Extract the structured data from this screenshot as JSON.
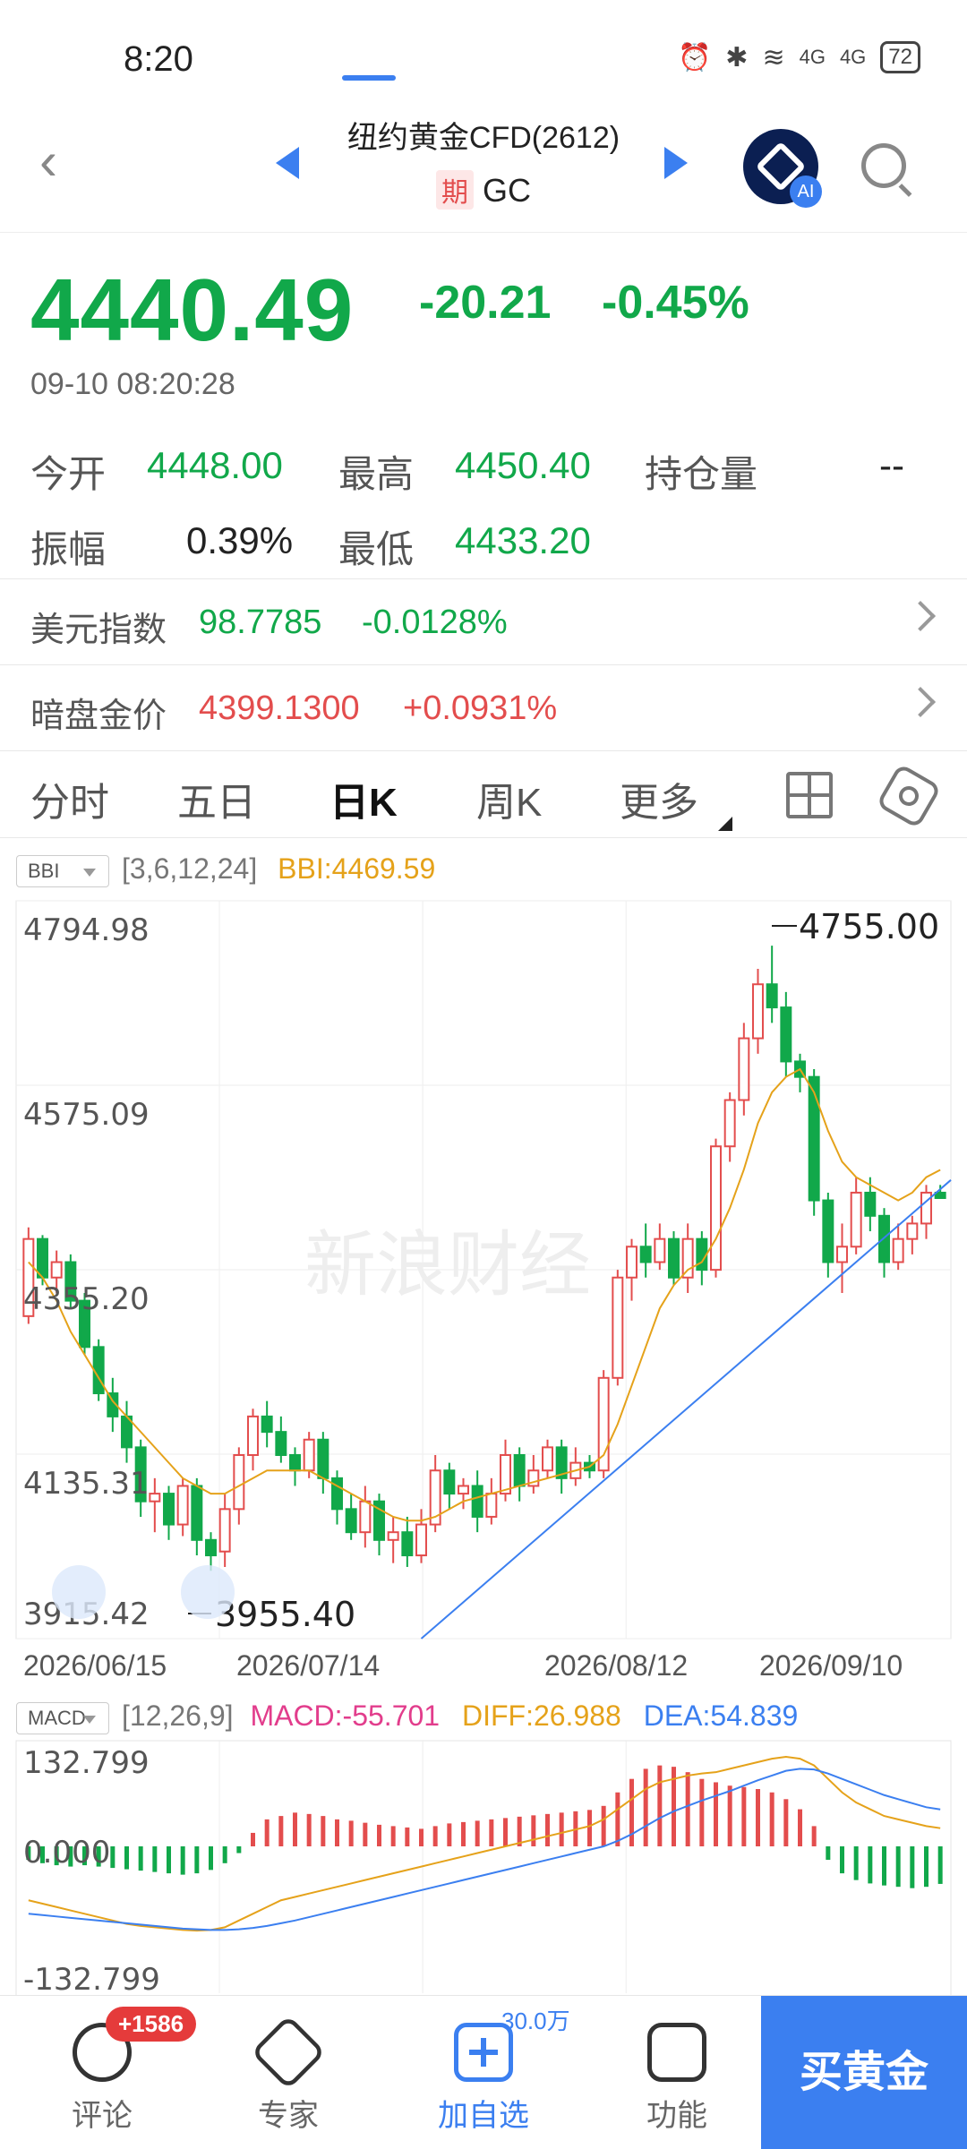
{
  "status_bar": {
    "time": "8:20",
    "battery": "72",
    "signal1": "4G",
    "signal2": "4G"
  },
  "header": {
    "title": "纽约黄金CFD(2612)",
    "subtitle_badge": "期",
    "subtitle": "GC",
    "ai_label": "AI"
  },
  "quote": {
    "price": "4440.49",
    "change": "-20.21",
    "change_pct": "-0.45%",
    "timestamp": "09-10 08:20:28",
    "color_down": "#11a84a",
    "color_up": "#e34d4d"
  },
  "stats": {
    "open_label": "今开",
    "open": "4448.00",
    "high_label": "最高",
    "high": "4450.40",
    "oi_label": "持仓量",
    "oi": "--",
    "amp_label": "振幅",
    "amp": "0.39%",
    "low_label": "最低",
    "low": "4433.20"
  },
  "usd_index": {
    "label": "美元指数",
    "value": "98.7785",
    "change": "-0.0128%"
  },
  "dark_pool": {
    "label": "暗盘金价",
    "value": "4399.1300",
    "change": "+0.0931%"
  },
  "tabs": [
    "分时",
    "五日",
    "日K",
    "周K",
    "更多"
  ],
  "active_tab": "日K",
  "bbi": {
    "select": "BBI",
    "params": "[3,6,12,24]",
    "value": "BBI:4469.59"
  },
  "kline": {
    "y_labels": [
      "4794.98",
      "4575.09",
      "4355.20",
      "4135.31",
      "3915.42"
    ],
    "max_label": "4755.00",
    "min_label": "3955.40",
    "watermark": "新浪财经",
    "dates": [
      "2026/06/15",
      "2026/07/14",
      "2026/08/12",
      "2026/09/10"
    ]
  },
  "macd": {
    "select": "MACD",
    "params": "[12,26,9]",
    "macd": "MACD:-55.701",
    "diff": "DIFF:26.988",
    "dea": "DEA:54.839",
    "y_labels": [
      "132.799",
      "0.000",
      "-132.799"
    ]
  },
  "bottom_bar": {
    "comment": "评论",
    "comment_badge": "+1586",
    "expert": "专家",
    "add": "加自选",
    "add_count": "30.0万",
    "function": "功能",
    "buy": "买黄金"
  },
  "chart_data": {
    "type": "candlestick",
    "ylim": [
      3915.42,
      4794.98
    ],
    "x_start": "2026/06/15",
    "x_end": "2026/09/10",
    "y_labels": [
      4794.98,
      4575.09,
      4355.2,
      4135.31,
      3915.42
    ],
    "max_marker": 4755.0,
    "min_marker": 3955.4,
    "bbi_last": 4469.59,
    "candles": [
      [
        4280,
        4380,
        4270,
        4395
      ],
      [
        4380,
        4330,
        4320,
        4385
      ],
      [
        4330,
        4350,
        4310,
        4365
      ],
      [
        4350,
        4300,
        4290,
        4360
      ],
      [
        4300,
        4240,
        4230,
        4310
      ],
      [
        4240,
        4180,
        4170,
        4250
      ],
      [
        4180,
        4150,
        4130,
        4200
      ],
      [
        4150,
        4110,
        4090,
        4170
      ],
      [
        4110,
        4040,
        4020,
        4120
      ],
      [
        4040,
        4050,
        4000,
        4070
      ],
      [
        4050,
        4010,
        3990,
        4060
      ],
      [
        4010,
        4060,
        3995,
        4070
      ],
      [
        4060,
        3990,
        3970,
        4070
      ],
      [
        3990,
        3970,
        3950,
        4000
      ],
      [
        3975,
        4030,
        3955,
        4050
      ],
      [
        4030,
        4100,
        4010,
        4110
      ],
      [
        4100,
        4150,
        4080,
        4160
      ],
      [
        4150,
        4130,
        4110,
        4170
      ],
      [
        4130,
        4100,
        4090,
        4150
      ],
      [
        4100,
        4080,
        4060,
        4110
      ],
      [
        4080,
        4120,
        4070,
        4130
      ],
      [
        4120,
        4070,
        4050,
        4130
      ],
      [
        4070,
        4030,
        4010,
        4080
      ],
      [
        4030,
        4000,
        3990,
        4050
      ],
      [
        4000,
        4040,
        3980,
        4060
      ],
      [
        4040,
        3990,
        3970,
        4050
      ],
      [
        3990,
        4000,
        3960,
        4020
      ],
      [
        4000,
        3970,
        3955,
        4020
      ],
      [
        3970,
        4010,
        3960,
        4030
      ],
      [
        4010,
        4080,
        4000,
        4100
      ],
      [
        4080,
        4050,
        4030,
        4090
      ],
      [
        4050,
        4060,
        4030,
        4070
      ],
      [
        4060,
        4020,
        4000,
        4080
      ],
      [
        4020,
        4050,
        4010,
        4070
      ],
      [
        4050,
        4100,
        4040,
        4120
      ],
      [
        4100,
        4060,
        4040,
        4110
      ],
      [
        4060,
        4080,
        4050,
        4100
      ],
      [
        4080,
        4110,
        4070,
        4120
      ],
      [
        4110,
        4070,
        4050,
        4120
      ],
      [
        4070,
        4090,
        4060,
        4110
      ],
      [
        4090,
        4080,
        4070,
        4100
      ],
      [
        4080,
        4200,
        4070,
        4210
      ],
      [
        4200,
        4330,
        4190,
        4340
      ],
      [
        4330,
        4370,
        4300,
        4380
      ],
      [
        4370,
        4350,
        4330,
        4400
      ],
      [
        4350,
        4380,
        4340,
        4400
      ],
      [
        4380,
        4330,
        4320,
        4390
      ],
      [
        4330,
        4380,
        4310,
        4400
      ],
      [
        4380,
        4340,
        4320,
        4390
      ],
      [
        4340,
        4500,
        4330,
        4510
      ],
      [
        4500,
        4560,
        4480,
        4570
      ],
      [
        4560,
        4640,
        4540,
        4660
      ],
      [
        4640,
        4710,
        4620,
        4730
      ],
      [
        4710,
        4680,
        4660,
        4760
      ],
      [
        4680,
        4610,
        4590,
        4700
      ],
      [
        4610,
        4590,
        4570,
        4620
      ],
      [
        4590,
        4430,
        4410,
        4600
      ],
      [
        4430,
        4350,
        4330,
        4440
      ],
      [
        4350,
        4370,
        4310,
        4400
      ],
      [
        4370,
        4440,
        4360,
        4460
      ],
      [
        4440,
        4410,
        4390,
        4460
      ],
      [
        4410,
        4350,
        4330,
        4420
      ],
      [
        4350,
        4380,
        4340,
        4400
      ],
      [
        4380,
        4400,
        4360,
        4410
      ],
      [
        4400,
        4440,
        4380,
        4450
      ],
      [
        4440,
        4433,
        4433,
        4450
      ]
    ],
    "bbi_series": [
      4350,
      4330,
      4300,
      4260,
      4230,
      4200,
      4170,
      4150,
      4130,
      4110,
      4090,
      4070,
      4060,
      4050,
      4050,
      4060,
      4070,
      4080,
      4080,
      4080,
      4080,
      4070,
      4060,
      4050,
      4040,
      4030,
      4020,
      4015,
      4015,
      4020,
      4030,
      4040,
      4045,
      4050,
      4055,
      4060,
      4065,
      4070,
      4075,
      4080,
      4085,
      4100,
      4140,
      4190,
      4240,
      4290,
      4320,
      4340,
      4350,
      4380,
      4420,
      4470,
      4530,
      4570,
      4590,
      4600,
      4570,
      4520,
      4480,
      4460,
      4450,
      4440,
      4430,
      4440,
      4460,
      4469.59
    ],
    "trendline": [
      [
        28,
        3915.42
      ],
      [
        65,
        4433.2
      ]
    ],
    "macd_hist": [
      -20,
      -25,
      -28,
      -30,
      -28,
      -30,
      -32,
      -34,
      -36,
      -38,
      -40,
      -42,
      -40,
      -35,
      -25,
      -10,
      20,
      40,
      45,
      50,
      48,
      45,
      40,
      38,
      35,
      32,
      30,
      28,
      26,
      30,
      34,
      36,
      38,
      40,
      42,
      44,
      46,
      48,
      50,
      52,
      54,
      60,
      80,
      100,
      115,
      120,
      118,
      110,
      100,
      95,
      90,
      88,
      85,
      80,
      70,
      55,
      30,
      -20,
      -40,
      -50,
      -55,
      -58,
      -60,
      -62,
      -60,
      -55.7
    ],
    "diff_series": [
      -80,
      -85,
      -90,
      -95,
      -100,
      -105,
      -110,
      -115,
      -118,
      -120,
      -122,
      -124,
      -125,
      -124,
      -120,
      -110,
      -100,
      -90,
      -80,
      -75,
      -70,
      -65,
      -60,
      -55,
      -50,
      -45,
      -40,
      -35,
      -30,
      -25,
      -20,
      -15,
      -10,
      -5,
      0,
      5,
      10,
      15,
      20,
      25,
      30,
      40,
      55,
      70,
      85,
      95,
      100,
      105,
      108,
      110,
      115,
      120,
      125,
      130,
      132.8,
      130,
      120,
      100,
      80,
      65,
      55,
      45,
      40,
      35,
      30,
      26.988
    ],
    "dea_series": [
      -100,
      -102,
      -104,
      -106,
      -108,
      -110,
      -112,
      -114,
      -116,
      -118,
      -120,
      -122,
      -123,
      -124,
      -124,
      -123,
      -121,
      -118,
      -114,
      -110,
      -105,
      -100,
      -95,
      -90,
      -85,
      -80,
      -75,
      -70,
      -65,
      -60,
      -55,
      -50,
      -45,
      -40,
      -35,
      -30,
      -25,
      -20,
      -15,
      -10,
      -5,
      0,
      8,
      18,
      30,
      42,
      52,
      60,
      68,
      75,
      82,
      90,
      98,
      105,
      112,
      115,
      114,
      108,
      100,
      92,
      84,
      76,
      70,
      64,
      58,
      54.839
    ]
  }
}
